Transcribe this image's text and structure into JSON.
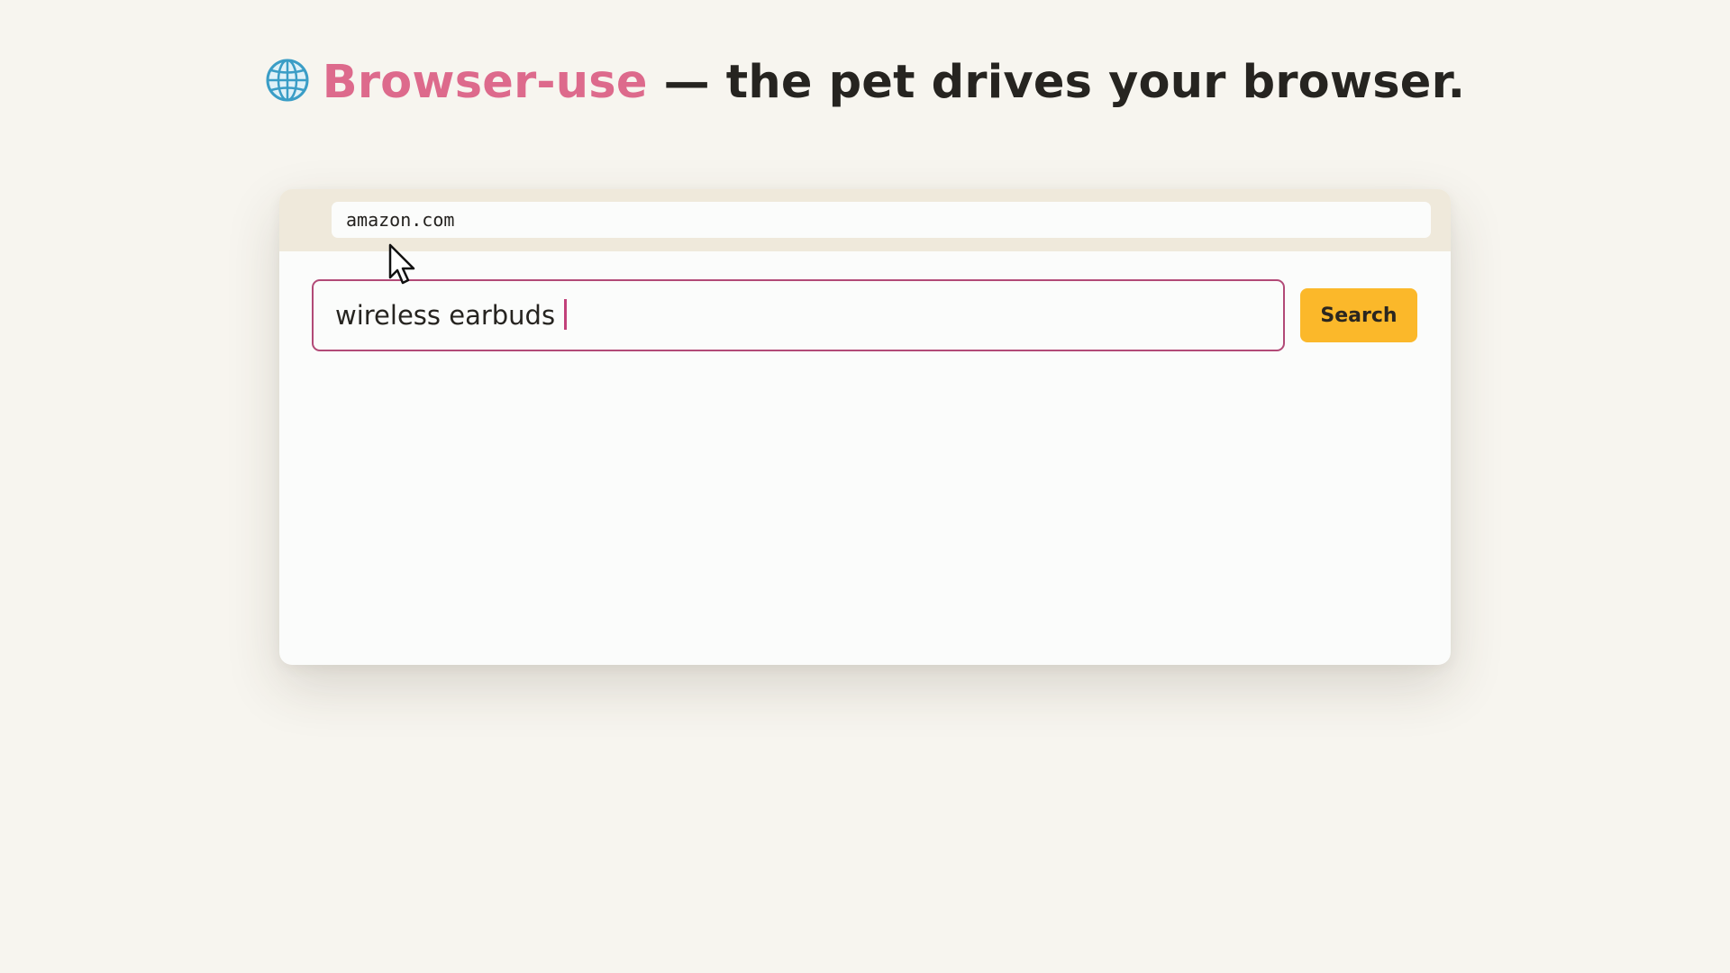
{
  "headline": {
    "icon": "globe-icon",
    "brand": "Browser-use",
    "rest": " — the pet drives your browser."
  },
  "browser": {
    "url": "amazon.com",
    "search": {
      "value": "wireless earbuds",
      "button_label": "Search"
    }
  },
  "colors": {
    "background": "#f7f5ef",
    "brand": "#dd6a8c",
    "input_border": "#b24a77",
    "button": "#fbb82a",
    "chrome_bar": "#efe9db"
  }
}
